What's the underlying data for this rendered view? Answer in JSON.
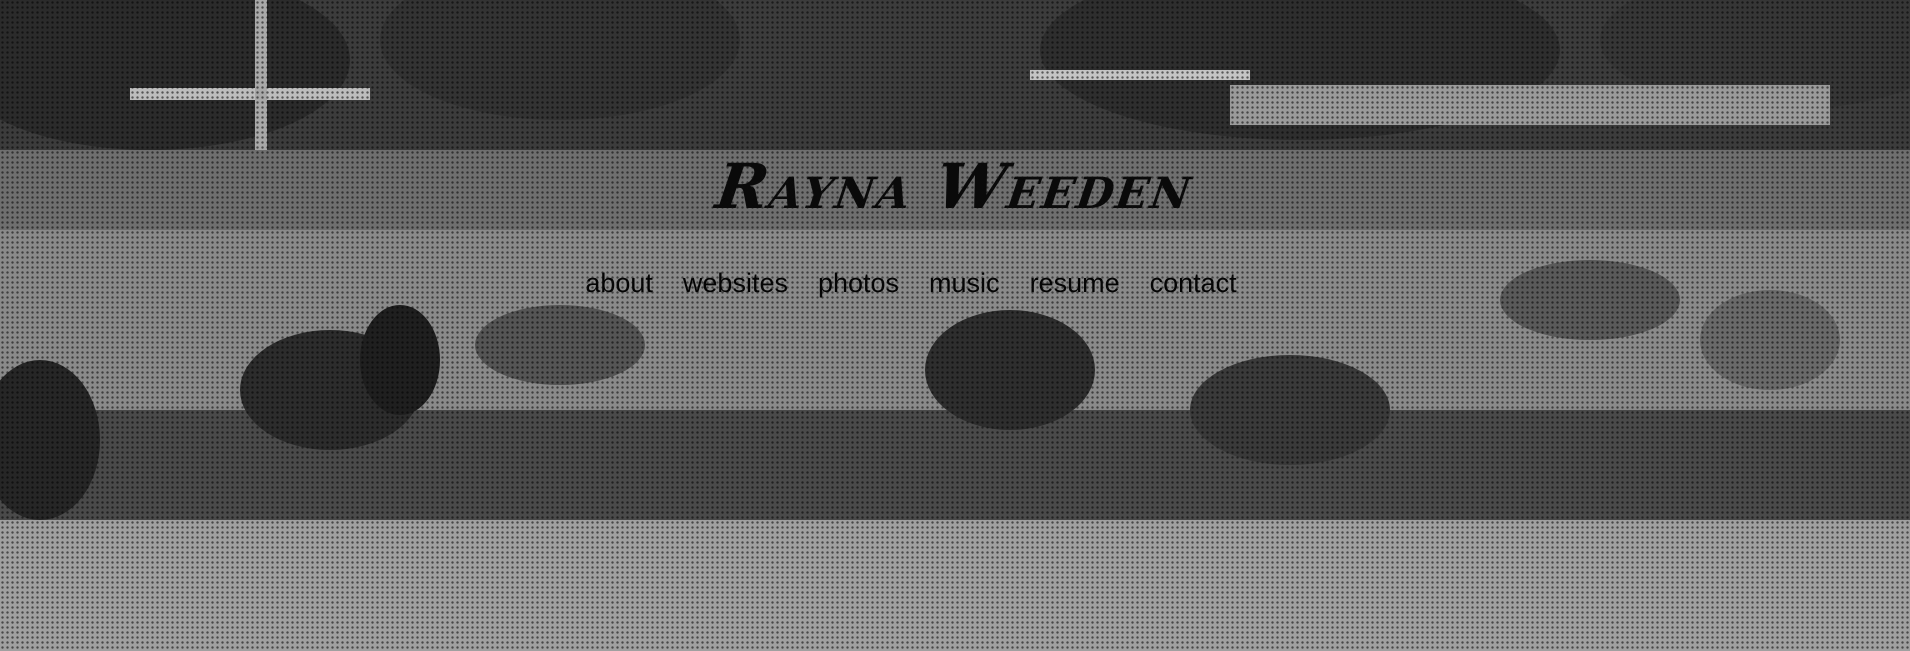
{
  "site": {
    "title": "Rayna Weeden"
  },
  "nav": {
    "items": [
      {
        "label": "about"
      },
      {
        "label": "websites"
      },
      {
        "label": "photos"
      },
      {
        "label": "music"
      },
      {
        "label": "resume"
      },
      {
        "label": "contact"
      }
    ]
  },
  "colors": {
    "text": "#000000",
    "overlay": "grayscale halftone"
  }
}
